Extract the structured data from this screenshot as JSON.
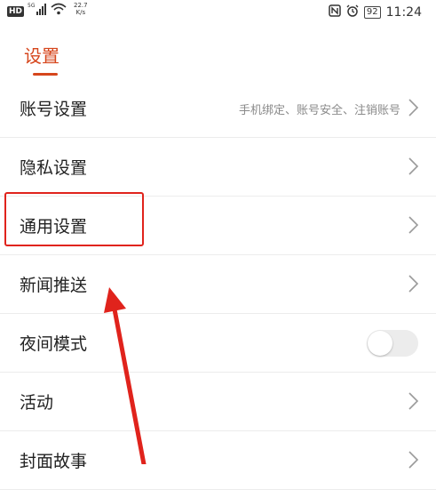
{
  "status_bar": {
    "network_type": "5G",
    "hd_label": "HD",
    "speed_value": "22.7",
    "speed_unit": "K/s",
    "battery": "92",
    "time": "11:24"
  },
  "header": {
    "title": "设置"
  },
  "settings": {
    "items": [
      {
        "label": "账号设置",
        "subtitle": "手机绑定、账号安全、注销账号"
      },
      {
        "label": "隐私设置"
      },
      {
        "label": "通用设置"
      },
      {
        "label": "新闻推送"
      },
      {
        "label": "夜间模式",
        "toggle_on": false
      },
      {
        "label": "活动"
      },
      {
        "label": "封面故事"
      }
    ]
  },
  "annotation": {
    "highlight_color": "#e0231c"
  },
  "colors": {
    "accent": "#d6461c",
    "divider": "#ececec",
    "chevron": "#9a9a9a"
  }
}
